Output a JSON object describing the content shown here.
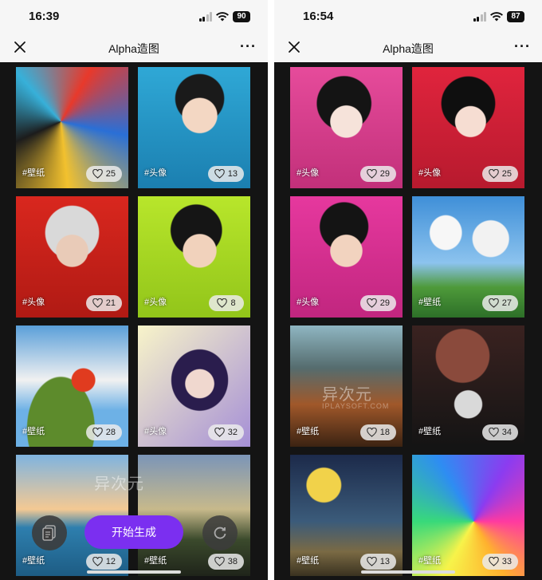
{
  "left": {
    "status": {
      "time": "16:39",
      "battery": "90"
    },
    "nav": {
      "title": "Alpha造图"
    },
    "cards": [
      {
        "tag": "#壁纸",
        "likes": "25",
        "scene": "abstract"
      },
      {
        "tag": "#头像",
        "likes": "13",
        "scene": "boy-blue"
      },
      {
        "tag": "#头像",
        "likes": "21",
        "scene": "silver-hair"
      },
      {
        "tag": "#头像",
        "likes": "8",
        "scene": "boy-lime"
      },
      {
        "tag": "#壁纸",
        "likes": "28",
        "scene": "island-umbrella"
      },
      {
        "tag": "#头像",
        "likes": "32",
        "scene": "girl-purple"
      },
      {
        "tag": "#壁纸",
        "likes": "12",
        "scene": "sea-sunset"
      },
      {
        "tag": "#壁纸",
        "likes": "38",
        "scene": "village-night"
      }
    ],
    "generate_label": "开始生成"
  },
  "right": {
    "status": {
      "time": "16:54",
      "battery": "87"
    },
    "nav": {
      "title": "Alpha造图"
    },
    "cards": [
      {
        "tag": "#头像",
        "likes": "29",
        "scene": "girl-pink"
      },
      {
        "tag": "#头像",
        "likes": "25",
        "scene": "boy-red"
      },
      {
        "tag": "#头像",
        "likes": "29",
        "scene": "glasses-boy"
      },
      {
        "tag": "#壁纸",
        "likes": "27",
        "scene": "clouds-valley"
      },
      {
        "tag": "#壁纸",
        "likes": "18",
        "scene": "mountains"
      },
      {
        "tag": "#壁纸",
        "likes": "34",
        "scene": "space-astronaut"
      },
      {
        "tag": "#壁纸",
        "likes": "13",
        "scene": "moon-night"
      },
      {
        "tag": "#壁纸",
        "likes": "33",
        "scene": "rainbow-swirl"
      }
    ]
  },
  "watermark": {
    "brand": "异次元",
    "site": "IPLAYSOFT.COM"
  },
  "colors": {
    "accent": "#7b2ff0",
    "background": "#141414",
    "bar": "#f6f6f6"
  }
}
